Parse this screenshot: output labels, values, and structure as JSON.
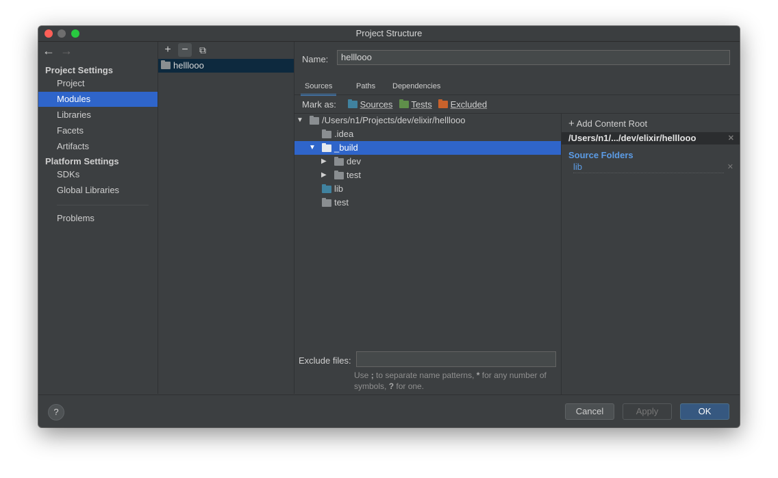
{
  "window": {
    "title": "Project Structure"
  },
  "sidebar": {
    "project_settings_heading": "Project Settings",
    "project_items": [
      "Project",
      "Modules",
      "Libraries",
      "Facets",
      "Artifacts"
    ],
    "platform_settings_heading": "Platform Settings",
    "platform_items": [
      "SDKs",
      "Global Libraries"
    ],
    "problems": "Problems",
    "selected": "Modules"
  },
  "modules_panel": {
    "toolbar": {
      "add": "+",
      "remove": "−",
      "copy": "⧉"
    },
    "modules": [
      "helllooo"
    ]
  },
  "module_settings": {
    "name_label": "Name:",
    "name_value": "helllooo",
    "tabs": [
      "Sources",
      "Paths",
      "Dependencies"
    ],
    "active_tab": "Sources",
    "mark_as_label": "Mark as:",
    "mark_as": [
      "Sources",
      "Tests",
      "Excluded"
    ],
    "tree": [
      {
        "label": "/Users/n1/Projects/dev/elixir/helllooo",
        "expanded": true
      },
      {
        "label": ".idea"
      },
      {
        "label": "_build",
        "expanded": true,
        "selected": true
      },
      {
        "label": "dev",
        "expanded": false
      },
      {
        "label": "test",
        "expanded": false
      },
      {
        "label": "lib",
        "type": "source"
      },
      {
        "label": "test"
      }
    ],
    "exclude_files_label": "Exclude files:",
    "exclude_files_value": "",
    "exclude_hint_1": "Use ",
    "exclude_hint_sep": ";",
    "exclude_hint_2": " to separate name patterns, ",
    "exclude_hint_star": "*",
    "exclude_hint_3": " for any number of symbols, ",
    "exclude_hint_q": "?",
    "exclude_hint_4": " for one."
  },
  "content_root": {
    "add_label": "Add Content Root",
    "root_path": "/Users/n1/.../dev/elixir/helllooo",
    "source_folders_heading": "Source Folders",
    "source_folders": [
      "lib"
    ]
  },
  "footer": {
    "help": "?",
    "cancel": "Cancel",
    "apply": "Apply",
    "ok": "OK"
  },
  "colors": {
    "accent_selection": "#2f65ca",
    "source_folder": "#40829f",
    "test_folder": "#5f8f4a",
    "excluded_folder": "#c8622c",
    "link_blue": "#5c9ce6"
  }
}
